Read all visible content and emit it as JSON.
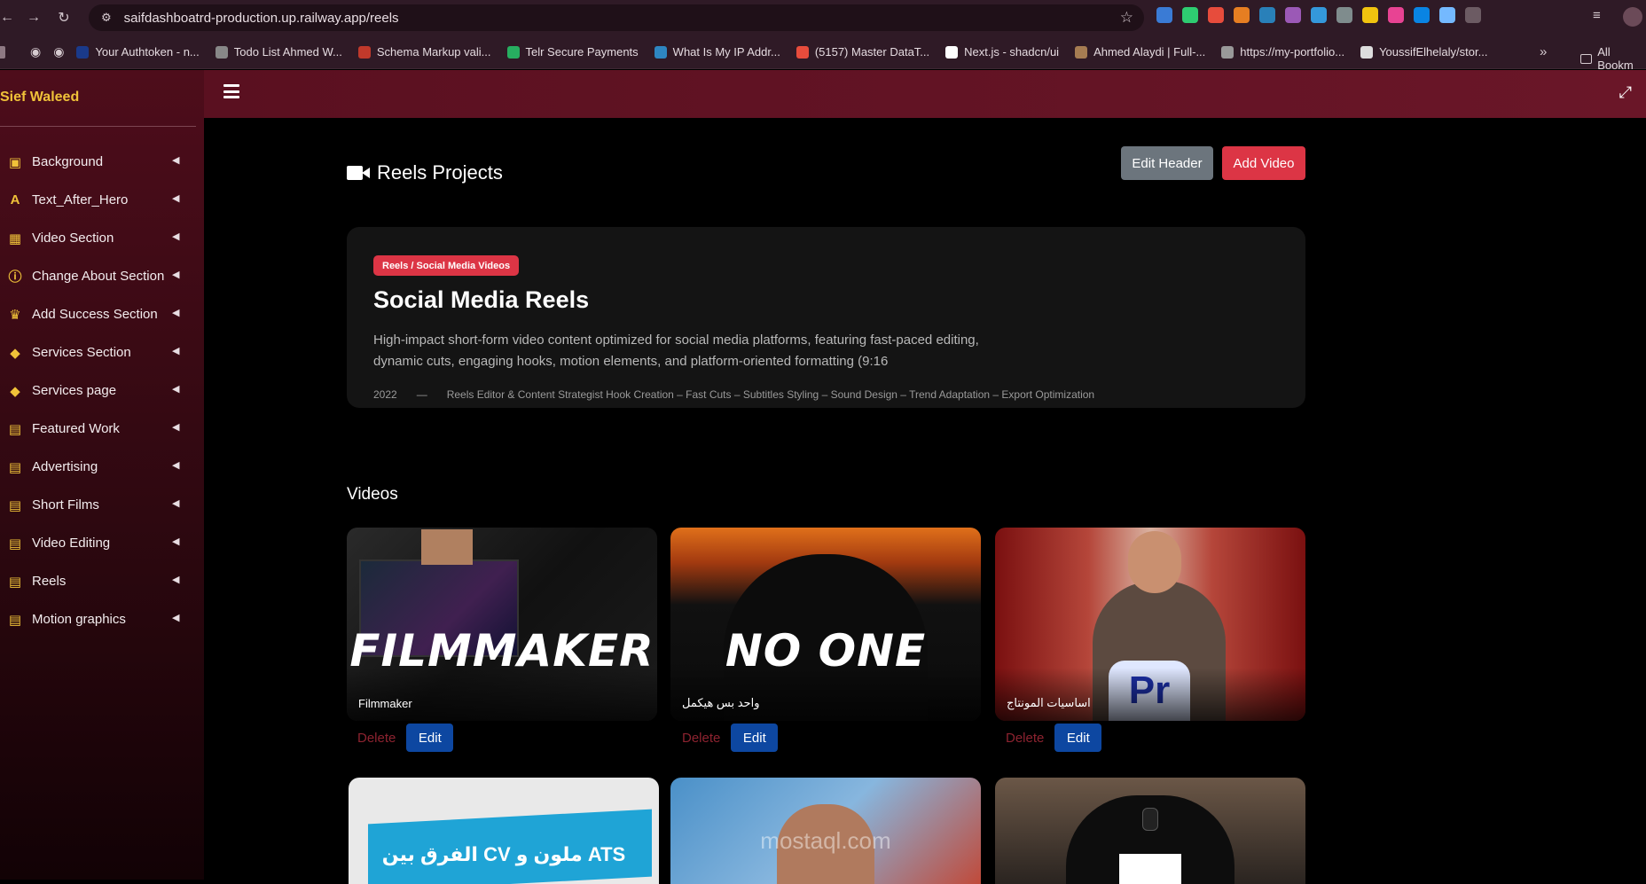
{
  "browser": {
    "url": "saifdashboatrd-production.up.railway.app/reels",
    "bookmarks": [
      {
        "label": "Your Authtoken - n...",
        "color": "#1a3a8a"
      },
      {
        "label": "Todo List Ahmed W...",
        "color": "#888888"
      },
      {
        "label": "Schema Markup vali...",
        "color": "#c0392b"
      },
      {
        "label": "Telr Secure Payments",
        "color": "#27ae60"
      },
      {
        "label": "What Is My IP Addr...",
        "color": "#2e86c1"
      },
      {
        "label": "(5157) Master DataT...",
        "color": "#e74c3c"
      },
      {
        "label": "Next.js - shadcn/ui",
        "color": "#ffffff"
      },
      {
        "label": "Ahmed Alaydi | Full-...",
        "color": "#a67c52"
      },
      {
        "label": "https://my-portfolio...",
        "color": "#999999"
      },
      {
        "label": "YoussifElhelaly/stor...",
        "color": "#dddddd"
      }
    ],
    "all_bookmarks": "All Bookm"
  },
  "sidebar": {
    "brand": "Sief Waleed",
    "items": [
      {
        "label": "Background",
        "icon": "image-icon"
      },
      {
        "label": "Text_After_Hero",
        "icon": "font-icon"
      },
      {
        "label": "Video Section",
        "icon": "film-icon"
      },
      {
        "label": "Change About Section",
        "icon": "info-icon"
      },
      {
        "label": "Add Success Section",
        "icon": "trophy-icon"
      },
      {
        "label": "Services Section",
        "icon": "tags-icon"
      },
      {
        "label": "Services page",
        "icon": "tags-icon"
      },
      {
        "label": "Featured Work",
        "icon": "clipboard-icon"
      },
      {
        "label": "Advertising",
        "icon": "clipboard-icon"
      },
      {
        "label": "Short Films",
        "icon": "clipboard-icon"
      },
      {
        "label": "Video Editing",
        "icon": "clipboard-icon"
      },
      {
        "label": "Reels",
        "icon": "clipboard-icon"
      },
      {
        "label": "Motion graphics",
        "icon": "clipboard-icon"
      }
    ]
  },
  "main": {
    "title": "Reels Projects",
    "edit_header": "Edit Header",
    "add_video": "Add Video",
    "hero": {
      "badge": "Reels / Social Media Videos",
      "title": "Social Media Reels",
      "description": "High-impact short-form video content optimized for social media platforms, featuring fast-paced editing, dynamic cuts, engaging hooks, motion elements, and platform-oriented formatting (9:16",
      "year": "2022",
      "dash": "—",
      "roles": "Reels Editor & Content Strategist Hook Creation – Fast Cuts – Subtitles Styling – Sound Design – Trend Adaptation – Export Optimization"
    },
    "videos_heading": "Videos",
    "videos": [
      {
        "overlay": "FILMMAKER",
        "caption": "Filmmaker",
        "delete": "Delete",
        "edit": "Edit"
      },
      {
        "overlay": "NO ONE",
        "caption": "واحد بس هيكمل",
        "delete": "Delete",
        "edit": "Edit"
      },
      {
        "overlay": "",
        "caption": "اساسيات المونتاج",
        "delete": "Delete",
        "edit": "Edit",
        "logo": "Pr"
      }
    ],
    "second_row": [
      {
        "text": "الفرق بين CV ملون و ATS"
      },
      {
        "text": "mostaql.com"
      },
      {
        "text": ""
      }
    ]
  }
}
